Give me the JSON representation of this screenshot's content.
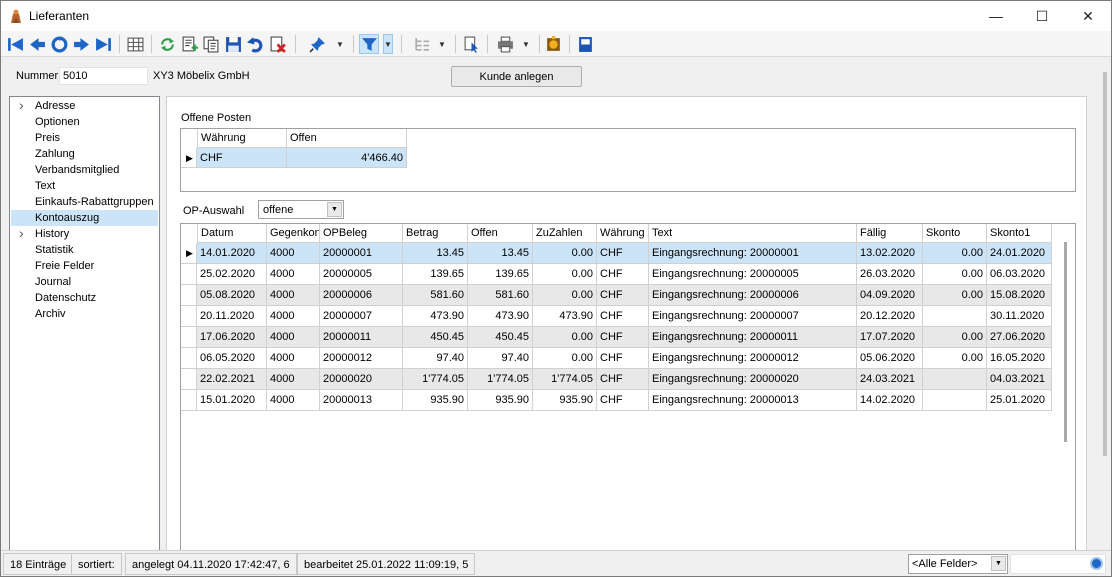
{
  "window": {
    "title": "Lieferanten"
  },
  "header": {
    "nummer_label": "Nummer",
    "nummer_value": "5010",
    "name": "XY3 Möbelix GmbH",
    "kunde_button": "Kunde anlegen"
  },
  "tree": {
    "items": [
      {
        "label": "Adresse",
        "expandable": true
      },
      {
        "label": "Optionen"
      },
      {
        "label": "Preis"
      },
      {
        "label": "Zahlung"
      },
      {
        "label": "Verbandsmitglied"
      },
      {
        "label": "Text"
      },
      {
        "label": "Einkaufs-Rabattgruppen"
      },
      {
        "label": "Kontoauszug",
        "selected": true
      },
      {
        "label": "History",
        "expandable": true
      },
      {
        "label": "Statistik"
      },
      {
        "label": "Freie Felder"
      },
      {
        "label": "Journal"
      },
      {
        "label": "Datenschutz"
      },
      {
        "label": "Archiv"
      }
    ]
  },
  "offene_posten": {
    "title": "Offene Posten",
    "columns": [
      "Währung",
      "Offen"
    ],
    "rows": [
      {
        "waehrung": "CHF",
        "offen": "4'466.40"
      }
    ]
  },
  "op_auswahl": {
    "label": "OP-Auswahl",
    "value": "offene"
  },
  "table": {
    "columns": [
      "Datum",
      "Gegenkonto",
      "OPBeleg",
      "Betrag",
      "Offen",
      "ZuZahlen",
      "Währung",
      "Text",
      "Fällig",
      "Skonto",
      "Skonto1"
    ],
    "rows": [
      [
        "14.01.2020",
        "4000",
        "20000001",
        "13.45",
        "13.45",
        "0.00",
        "CHF",
        "Eingangsrechnung: 20000001",
        "13.02.2020",
        "0.00",
        "24.01.2020"
      ],
      [
        "25.02.2020",
        "4000",
        "20000005",
        "139.65",
        "139.65",
        "0.00",
        "CHF",
        "Eingangsrechnung: 20000005",
        "26.03.2020",
        "0.00",
        "06.03.2020"
      ],
      [
        "05.08.2020",
        "4000",
        "20000006",
        "581.60",
        "581.60",
        "0.00",
        "CHF",
        "Eingangsrechnung: 20000006",
        "04.09.2020",
        "0.00",
        "15.08.2020"
      ],
      [
        "20.11.2020",
        "4000",
        "20000007",
        "473.90",
        "473.90",
        "473.90",
        "CHF",
        "Eingangsrechnung: 20000007",
        "20.12.2020",
        "",
        "30.11.2020"
      ],
      [
        "17.06.2020",
        "4000",
        "20000011",
        "450.45",
        "450.45",
        "0.00",
        "CHF",
        "Eingangsrechnung: 20000011",
        "17.07.2020",
        "0.00",
        "27.06.2020"
      ],
      [
        "06.05.2020",
        "4000",
        "20000012",
        "97.40",
        "97.40",
        "0.00",
        "CHF",
        "Eingangsrechnung: 20000012",
        "05.06.2020",
        "0.00",
        "16.05.2020"
      ],
      [
        "22.02.2021",
        "4000",
        "20000020",
        "1'774.05",
        "1'774.05",
        "1'774.05",
        "CHF",
        "Eingangsrechnung: 20000020",
        "24.03.2021",
        "",
        "04.03.2021"
      ],
      [
        "15.01.2020",
        "4000",
        "20000013",
        "935.90",
        "935.90",
        "935.90",
        "CHF",
        "Eingangsrechnung: 20000013",
        "14.02.2020",
        "",
        "25.01.2020"
      ]
    ]
  },
  "status": {
    "count": "18 Einträge",
    "sorted": "sortiert:",
    "created": "angelegt 04.11.2020 17:42:47,  6",
    "edited": "bearbeitet 25.01.2022 11:09:19,  5",
    "field_filter": "<Alle Felder>"
  },
  "colors": {
    "selection": "#cce4f7",
    "alt_row": "#e8e8e8",
    "accent": "#1e66c6"
  }
}
